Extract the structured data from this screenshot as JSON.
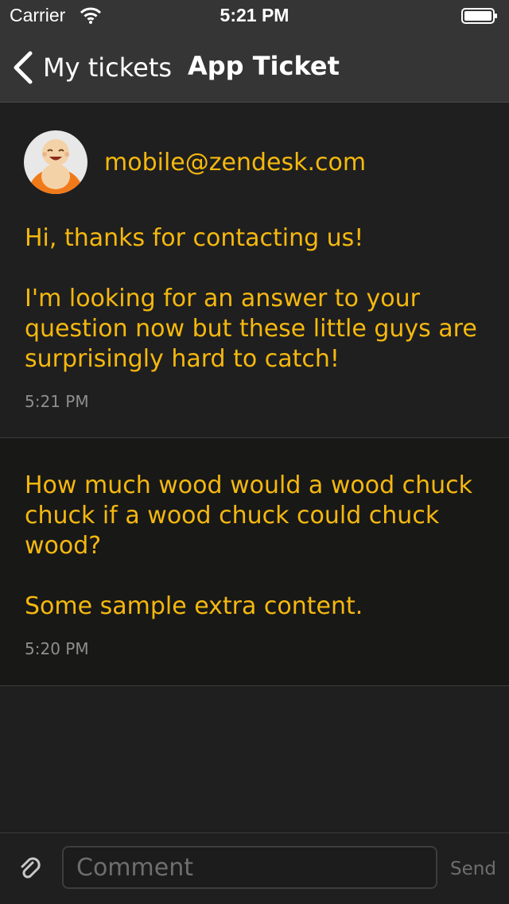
{
  "status_bar": {
    "carrier": "Carrier",
    "time": "5:21 PM"
  },
  "nav": {
    "back_label": "My tickets",
    "title": "App Ticket"
  },
  "messages": [
    {
      "author": "mobile@zendesk.com",
      "paragraphs": [
        "Hi, thanks for contacting us!",
        "I'm looking for an answer to your question now but these little guys are surprisingly hard to catch!"
      ],
      "time": "5:21 PM"
    },
    {
      "paragraphs": [
        "How much wood would a wood chuck chuck if a wood chuck could chuck wood?",
        "Some sample extra content."
      ],
      "time": "5:20 PM"
    }
  ],
  "composer": {
    "placeholder": "Comment",
    "send_label": "Send"
  },
  "colors": {
    "accent": "#f5b80f",
    "background": "#1f1f1f",
    "navbar": "#363535",
    "timestamp": "#8e8e8e"
  },
  "icons": {
    "back": "chevron-left-icon",
    "wifi": "wifi-icon",
    "battery": "battery-icon",
    "attach": "paperclip-icon"
  }
}
